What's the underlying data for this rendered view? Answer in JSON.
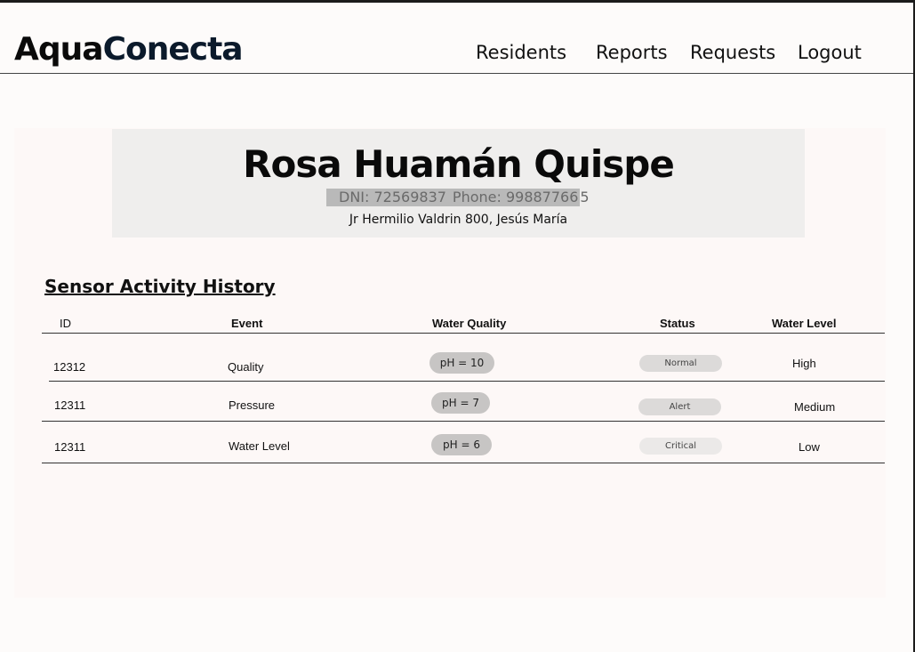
{
  "app": {
    "brand_part1": "Aqua",
    "brand_part2": "Conecta"
  },
  "nav": {
    "items": [
      "Residents",
      "Reports",
      "Requests",
      "Logout"
    ]
  },
  "resident": {
    "name": "Rosa Huamán Quispe",
    "dni": "DNI: 72569837",
    "phone_prefix": "Phone: 99887766",
    "phone_suffix": "5",
    "address": "Jr Hermilio Valdrin 800, Jesús María"
  },
  "history": {
    "title": "Sensor Activity History",
    "columns": [
      "ID",
      "Event",
      "Water Quality",
      "Status",
      "Water Level"
    ],
    "rows": [
      {
        "id": "12312",
        "event": "Quality",
        "water_quality": "pH = 10",
        "status": "Normal",
        "water_level": "High"
      },
      {
        "id": "12311",
        "event": "Pressure",
        "water_quality": "pH = 7",
        "status": "Alert",
        "water_level": "Medium"
      },
      {
        "id": "12311",
        "event": "Water Level",
        "water_quality": "pH = 6",
        "status": "Critical",
        "water_level": "Low"
      }
    ]
  },
  "colors": {
    "status_normal": "#dcdad9",
    "status_alert": "#dcdad9",
    "status_critical": "#ebe9e8",
    "ph_pill": "#c7c5c4",
    "card_bg": "#efeeed"
  }
}
